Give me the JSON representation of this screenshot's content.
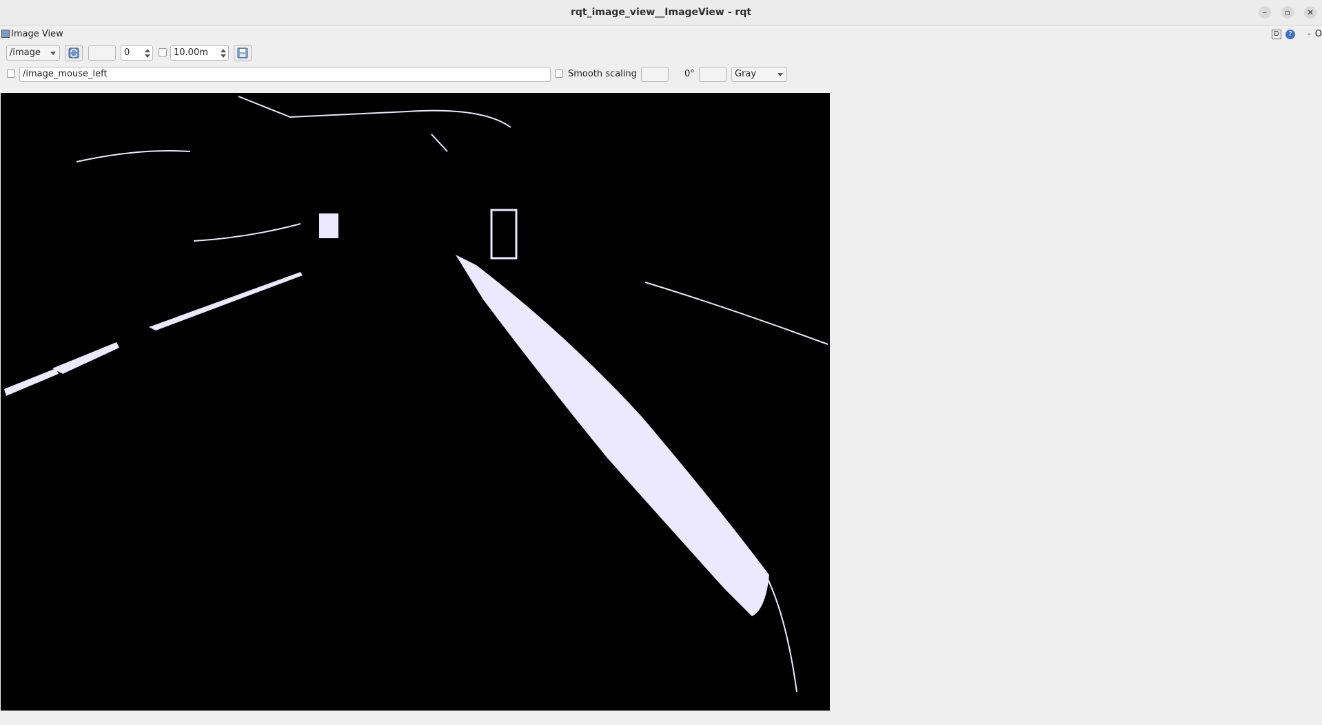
{
  "window": {
    "title": "rqt_image_view__ImageView - rqt"
  },
  "dock": {
    "title": "Image View",
    "right_d": "D",
    "right_help": "?",
    "right_dash": "-",
    "right_o": "O"
  },
  "toolbar": {
    "topic": "/image",
    "empty_field_1": "",
    "spin_value": "0",
    "range_value": "10.00m"
  },
  "row2": {
    "mouse_topic": "/image_mouse_left",
    "smooth_scaling_label": "Smooth scaling",
    "empty_field_2": "",
    "rotation_label": "0°",
    "empty_field_3": "",
    "color_scheme": "Gray"
  },
  "icons": {
    "app_icon": "image-view-icon",
    "refresh": "refresh-icon",
    "save": "save-icon",
    "minimize": "minimize-icon",
    "maximize": "maximize-icon",
    "close": "close-icon"
  },
  "colors": {
    "image_background": "#000000",
    "lane_marking": "#ece9ff",
    "help_icon": "#3d72c4"
  }
}
